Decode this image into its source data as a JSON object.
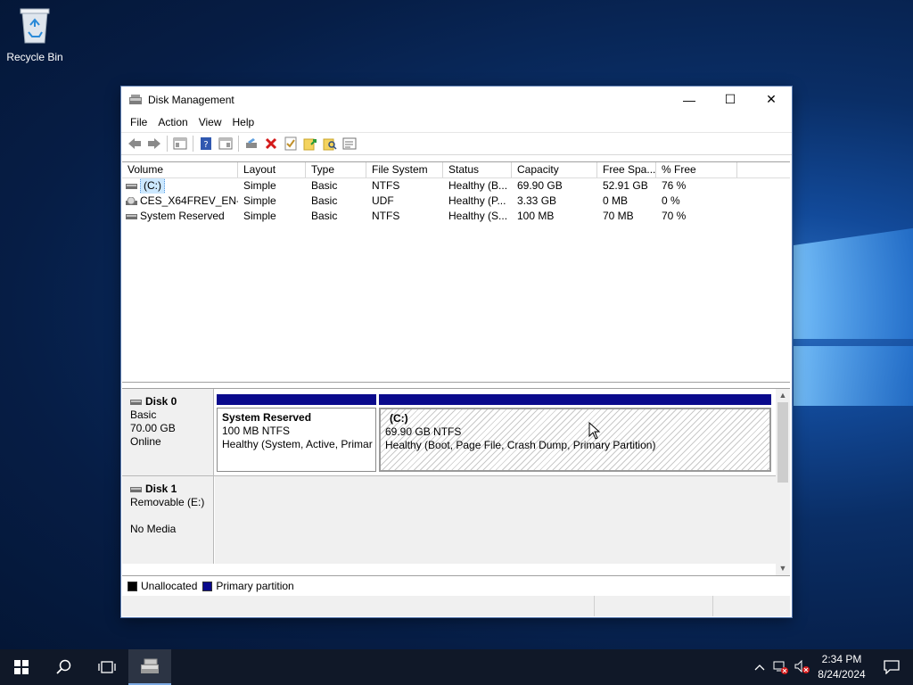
{
  "desktop": {
    "recycle_bin_label": "Recycle Bin"
  },
  "window": {
    "title": "Disk Management",
    "minimize_label": "—",
    "maximize_label": "☐",
    "close_label": "✕"
  },
  "menu": {
    "items": [
      "File",
      "Action",
      "View",
      "Help"
    ]
  },
  "volume_list": {
    "columns": [
      "Volume",
      "Layout",
      "Type",
      "File System",
      "Status",
      "Capacity",
      "Free Spa...",
      "% Free"
    ],
    "rows": [
      {
        "volume": "(C:)",
        "layout": "Simple",
        "type": "Basic",
        "fs": "NTFS",
        "status": "Healthy (B...",
        "capacity": "69.90 GB",
        "free": "52.91 GB",
        "pct": "76 %"
      },
      {
        "volume": "CES_X64FREV_EN-...",
        "layout": "Simple",
        "type": "Basic",
        "fs": "UDF",
        "status": "Healthy (P...",
        "capacity": "3.33 GB",
        "free": "0 MB",
        "pct": "0 %"
      },
      {
        "volume": "System Reserved",
        "layout": "Simple",
        "type": "Basic",
        "fs": "NTFS",
        "status": "Healthy (S...",
        "capacity": "100 MB",
        "free": "70 MB",
        "pct": "70 %"
      }
    ]
  },
  "disks": {
    "disk0": {
      "name": "Disk 0",
      "type": "Basic",
      "size": "70.00 GB",
      "state": "Online",
      "partitions": [
        {
          "name": "System Reserved",
          "size": "100 MB NTFS",
          "status": "Healthy (System, Active, Primar"
        },
        {
          "name": "(C:)",
          "size": "69.90 GB NTFS",
          "status": "Healthy (Boot, Page File, Crash Dump, Primary Partition)"
        }
      ]
    },
    "disk1": {
      "name": "Disk 1",
      "type": "Removable (E:)",
      "state": "No Media"
    }
  },
  "legend": {
    "unallocated": "Unallocated",
    "primary": "Primary partition",
    "unallocated_color": "#000000",
    "primary_color": "#0a0a8c"
  },
  "taskbar": {
    "time": "2:34 PM",
    "date": "8/24/2024"
  }
}
